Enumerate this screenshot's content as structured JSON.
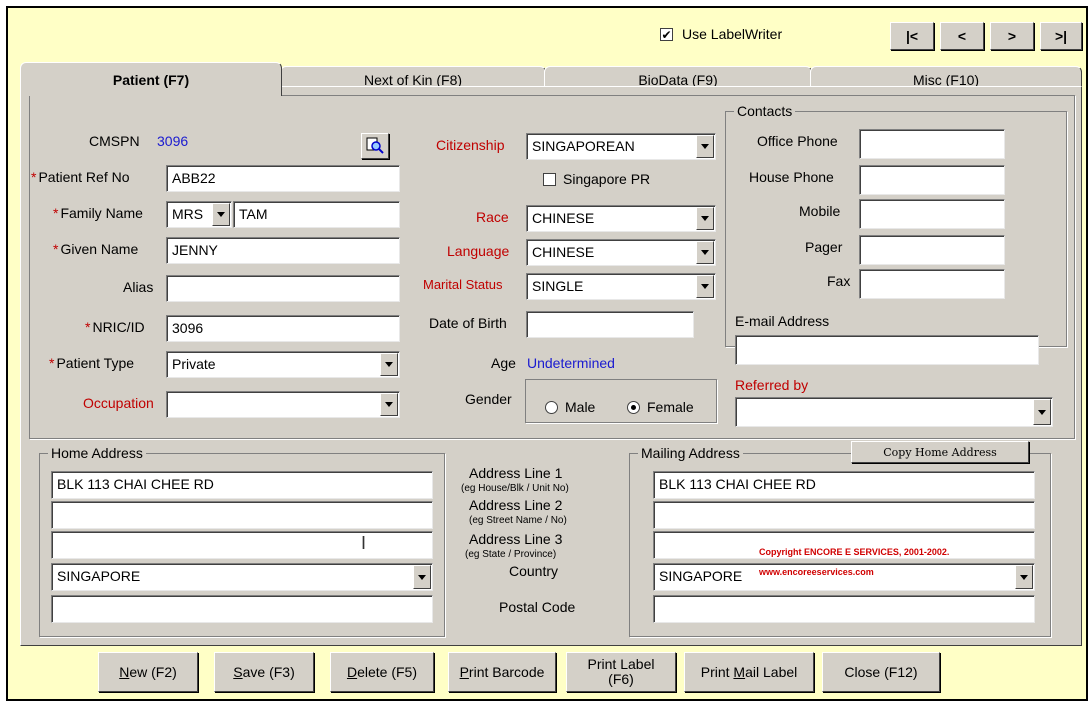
{
  "nav": {
    "use_labelwriter_label": "Use LabelWriter",
    "use_labelwriter_checked": "✔",
    "first": "|<",
    "prev": "<",
    "next": ">",
    "last": ">|"
  },
  "tabs": [
    {
      "label": "Patient (F7)"
    },
    {
      "label": "Next of Kin (F8)"
    },
    {
      "label": "BioData (F9)"
    },
    {
      "label": "Misc (F10)"
    }
  ],
  "patient": {
    "cmspn_label": "CMSPN",
    "cmspn_value": "3096",
    "ref_no_label": "Patient Ref No",
    "ref_no_value": "ABB22",
    "family_name_label": "Family Name",
    "salutation": "MRS",
    "family_name_value": "TAM",
    "given_name_label": "Given Name",
    "given_name_value": "JENNY",
    "alias_label": "Alias",
    "alias_value": "",
    "nric_label": "NRIC/ID",
    "nric_value": "3096",
    "patient_type_label": "Patient Type",
    "patient_type_value": "Private",
    "occupation_label": "Occupation",
    "occupation_value": "",
    "required_marker": "*"
  },
  "demographics": {
    "citizenship_label": "Citizenship",
    "citizenship_value": "SINGAPOREAN",
    "singapore_pr_label": "Singapore PR",
    "race_label": "Race",
    "race_value": "CHINESE",
    "language_label": "Language",
    "language_value": "CHINESE",
    "marital_label": "Marital Status",
    "marital_value": "SINGLE",
    "dob_label": "Date of Birth",
    "dob_value": "",
    "age_label": "Age",
    "age_value": "Undetermined",
    "gender_label": "Gender",
    "male_label": "Male",
    "female_label": "Female"
  },
  "contacts": {
    "title": "Contacts",
    "office_phone_label": "Office Phone",
    "house_phone_label": "House Phone",
    "mobile_label": "Mobile",
    "pager_label": "Pager",
    "fax_label": "Fax",
    "email_label": "E-mail Address",
    "referred_by_label": "Referred by"
  },
  "home_address": {
    "title": "Home Address",
    "line1": "BLK 113 CHAI CHEE RD",
    "line2": "",
    "line3": "",
    "country": "SINGAPORE",
    "postal": ""
  },
  "address_labels": {
    "line1": "Address Line 1",
    "line1_hint": "(eg House/Blk / Unit No)",
    "line2": "Address Line 2",
    "line2_hint": "(eg Street Name / No)",
    "line3": "Address Line 3",
    "line3_hint": "(eg State / Province)",
    "country": "Country",
    "postal": "Postal Code"
  },
  "mailing_address": {
    "title": "Mailing Address",
    "copy_button": "Copy Home Address",
    "line1": "BLK 113 CHAI CHEE RD",
    "line2": "",
    "line3": "",
    "country": "SINGAPORE",
    "postal": "",
    "copyright_line1": "Copyright ENCORE E SERVICES, 2001-2002.",
    "copyright_line2": "www.encoreeservices.com"
  },
  "footer": {
    "new_u": "N",
    "new_rest": "ew (F2)",
    "save_u": "S",
    "save_rest": "ave (F3)",
    "delete_u": "D",
    "delete_rest": "elete (F5)",
    "barcode_u": "P",
    "barcode_rest": "rint Barcode",
    "label_line1": "Print Label",
    "label_line2": "(F6)",
    "mail_pre": "Print ",
    "mail_u": "M",
    "mail_rest": "ail Label",
    "close": "Close (F12)"
  },
  "colors": {
    "window_bg": "#ffffc6",
    "panel_bg": "#d4d0c8",
    "required_red": "#c00000",
    "value_blue": "#1a1ad0"
  }
}
